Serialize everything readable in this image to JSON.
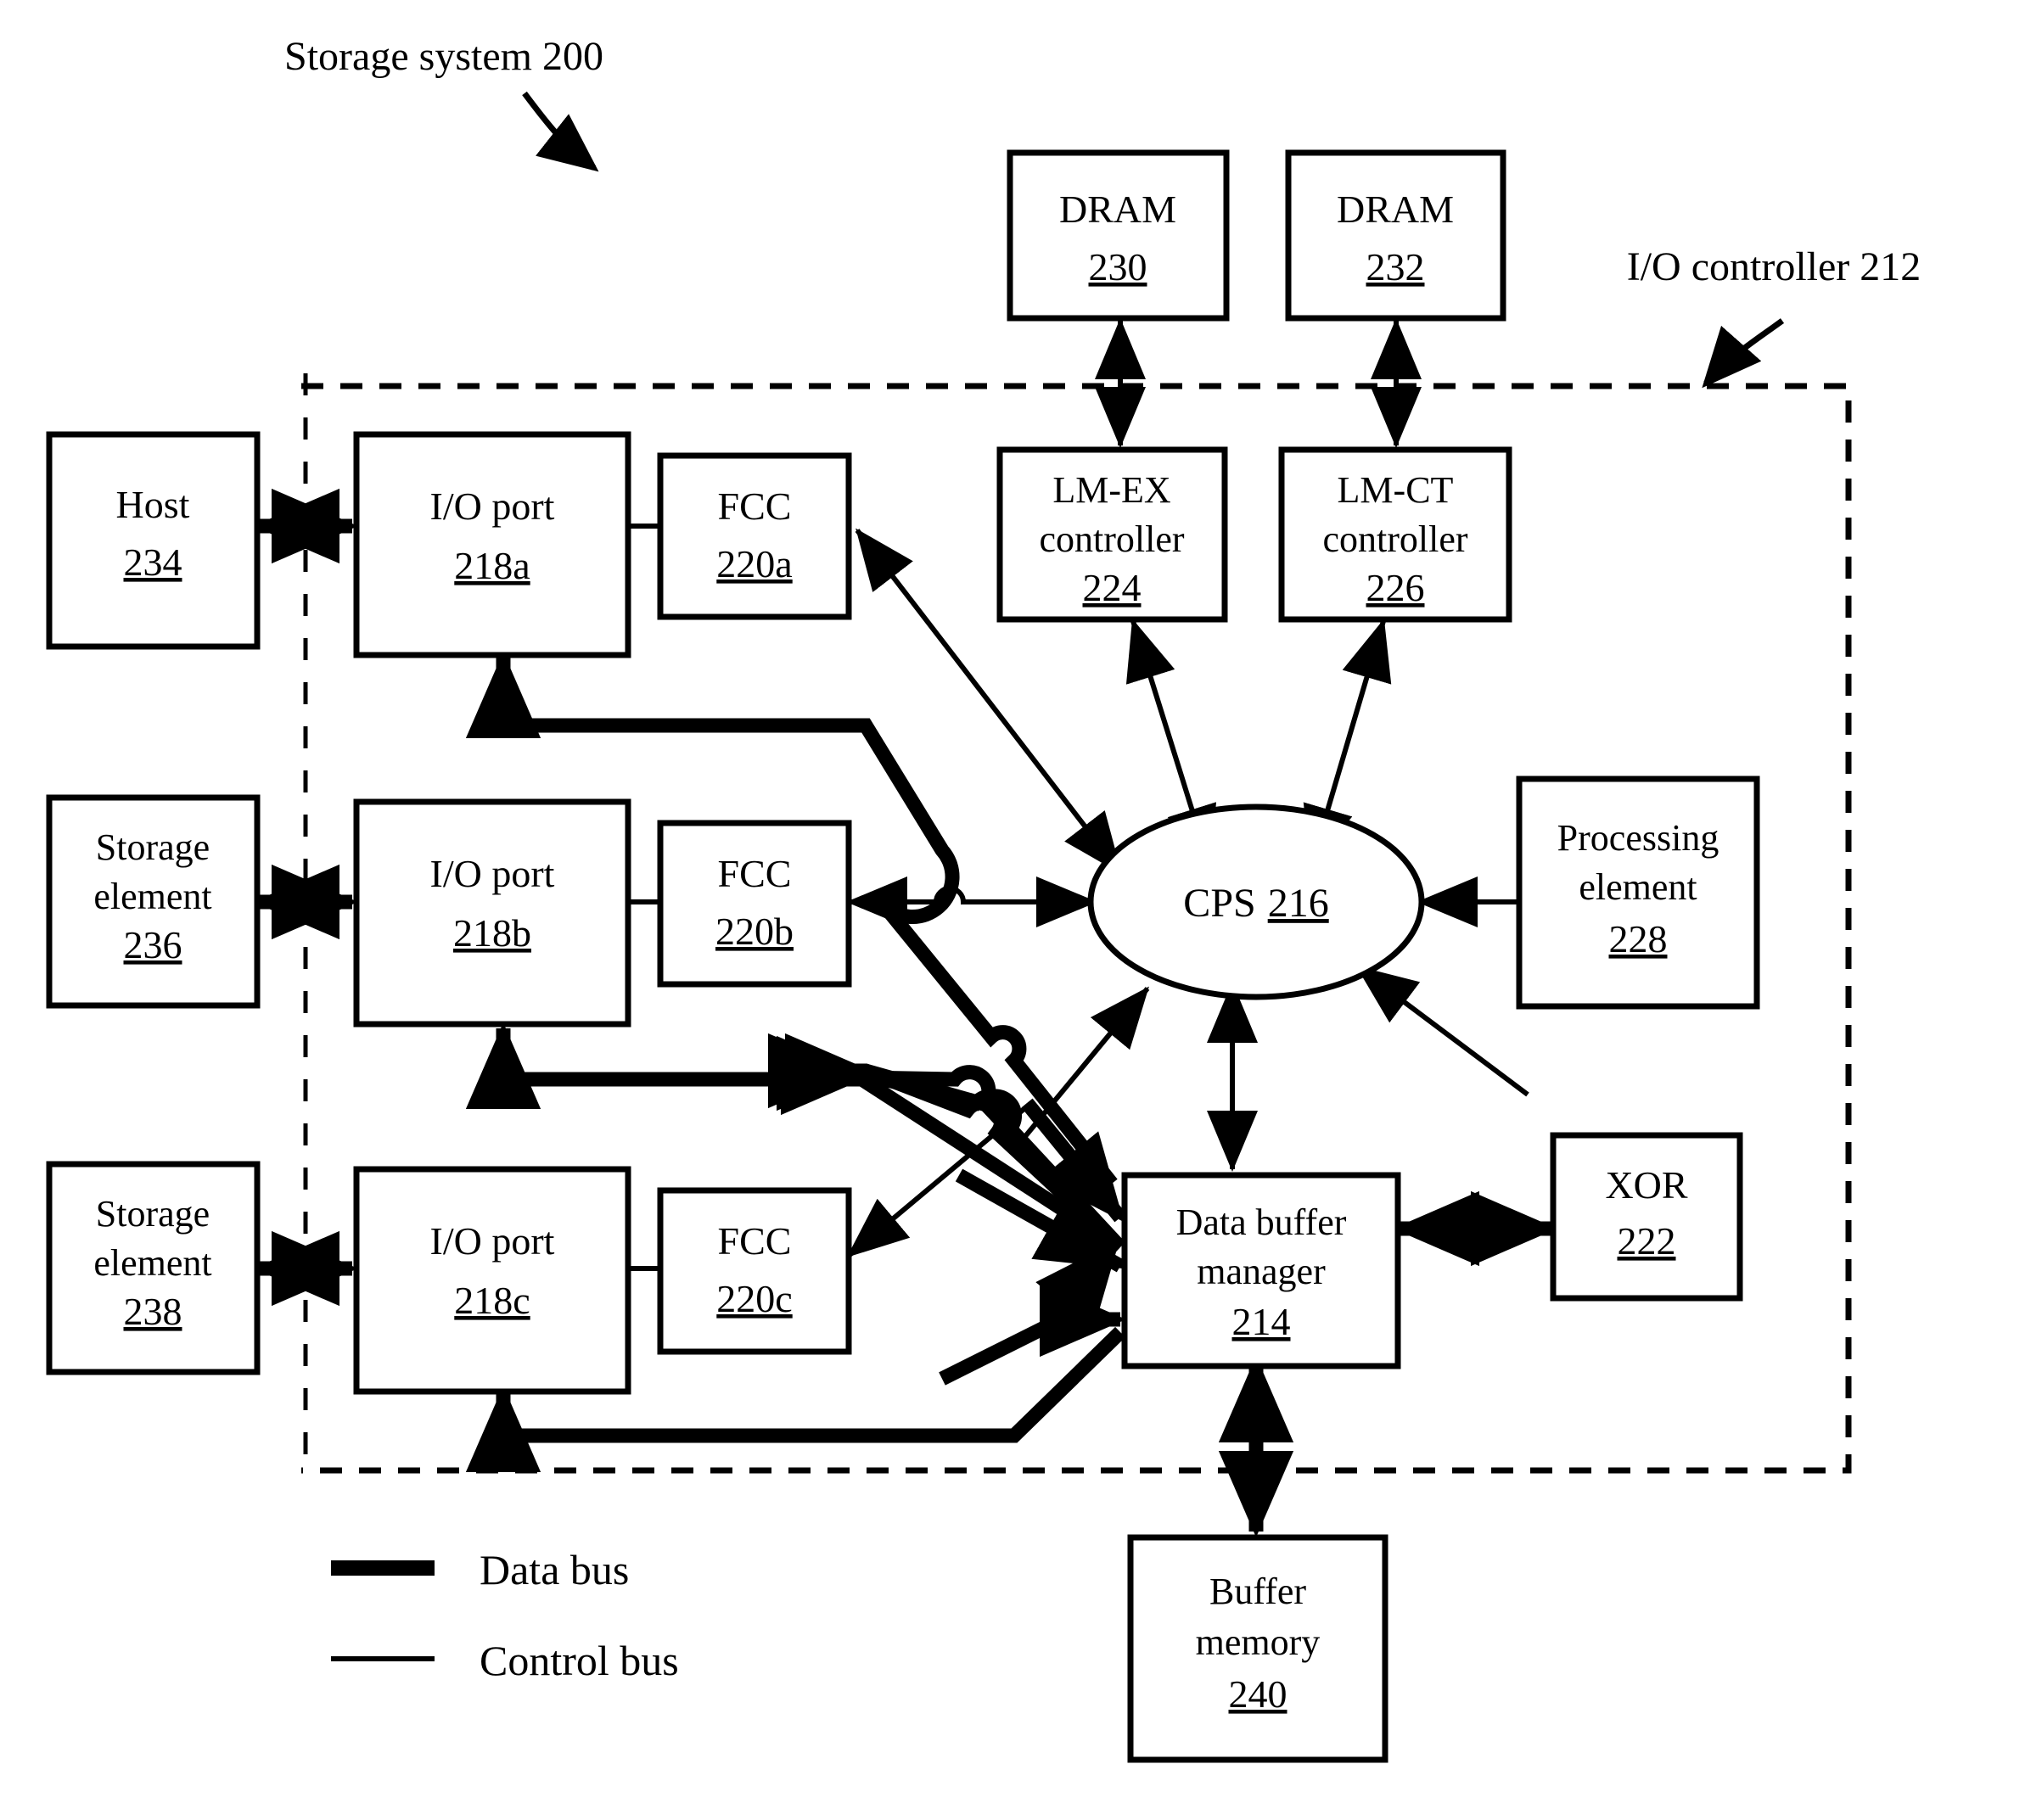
{
  "figure": {
    "title_callout": "Storage system 200",
    "controller_callout": "I/O controller 212"
  },
  "nodes": {
    "dram230": {
      "line1": "DRAM",
      "ref": "230"
    },
    "dram232": {
      "line1": "DRAM",
      "ref": "232"
    },
    "lmex": {
      "line1": "LM-EX",
      "line2": "controller",
      "ref": "224"
    },
    "lmct": {
      "line1": "LM-CT",
      "line2": "controller",
      "ref": "226"
    },
    "host": {
      "line1": "Host",
      "ref": "234"
    },
    "storage236": {
      "line1": "Storage",
      "line2": "element",
      "ref": "236"
    },
    "storage238": {
      "line1": "Storage",
      "line2": "element",
      "ref": "238"
    },
    "ioport_a": {
      "line1": "I/O port",
      "ref": "218a"
    },
    "ioport_b": {
      "line1": "I/O port",
      "ref": "218b"
    },
    "ioport_c": {
      "line1": "I/O port",
      "ref": "218c"
    },
    "fcc_a": {
      "line1": "FCC",
      "ref": "220a"
    },
    "fcc_b": {
      "line1": "FCC",
      "ref": "220b"
    },
    "fcc_c": {
      "line1": "FCC",
      "ref": "220c"
    },
    "cps": {
      "label": "CPS",
      "ref": "216"
    },
    "processing": {
      "line1": "Processing",
      "line2": "element",
      "ref": "228"
    },
    "xor": {
      "line1": "XOR",
      "ref": "222"
    },
    "dbm": {
      "line1": "Data buffer",
      "line2": "manager",
      "ref": "214"
    },
    "buffermem": {
      "line1": "Buffer",
      "line2": "memory",
      "ref": "240"
    }
  },
  "legend": {
    "items": [
      {
        "label": "Data bus",
        "style": "thick"
      },
      {
        "label": "Control bus",
        "style": "thin"
      }
    ]
  },
  "colors": {
    "ink": "#000000",
    "paper": "#ffffff"
  }
}
